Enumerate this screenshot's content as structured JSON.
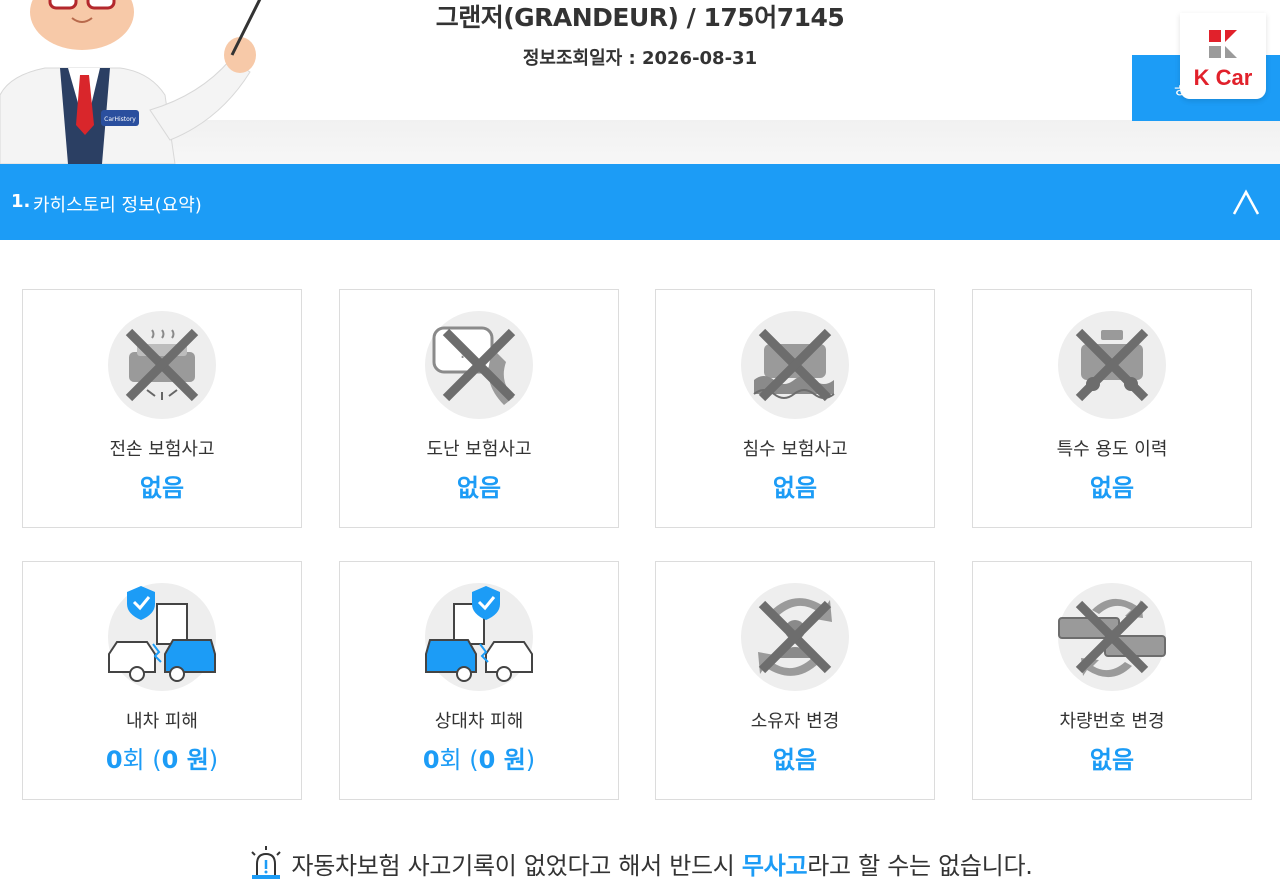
{
  "header": {
    "title": "그랜저(GRANDEUR) / 175어7145",
    "lookup_label": "정보조회일자 : ",
    "lookup_date": "2026-08-31",
    "side_button_label": "ㅎ",
    "brand_logo_text": "K Car",
    "mascot_badge_text": "CarHistory"
  },
  "section": {
    "number": "1.",
    "title": "카히스토리 정보(요약)",
    "toggle_icon": "chevron-up-icon"
  },
  "cards": [
    {
      "label": "전손 보험사고",
      "value": "없음",
      "icon": "total-loss-icon"
    },
    {
      "label": "도난 보험사고",
      "value": "없음",
      "icon": "theft-icon"
    },
    {
      "label": "침수 보험사고",
      "value": "없음",
      "icon": "flood-icon"
    },
    {
      "label": "특수 용도 이력",
      "value": "없음",
      "icon": "special-use-icon"
    },
    {
      "label": "내차 피해",
      "count": "0",
      "count_unit": "회",
      "amount_open": " (",
      "amount": "0",
      "amount_unit": " 원",
      "amount_close": ")",
      "icon": "my-car-damage-icon"
    },
    {
      "label": "상대차 피해",
      "count": "0",
      "count_unit": "회",
      "amount_open": " (",
      "amount": "0",
      "amount_unit": " 원",
      "amount_close": ")",
      "icon": "other-car-damage-icon"
    },
    {
      "label": "소유자 변경",
      "value": "없음",
      "icon": "owner-change-icon"
    },
    {
      "label": "차량번호 변경",
      "value": "없음",
      "icon": "plate-change-icon"
    }
  ],
  "notice": {
    "before": "자동차보험 사고기록이 없었다고 해서 반드시 ",
    "highlight": "무사고",
    "after": "라고 할 수는 없습니다.",
    "icon": "siren-icon"
  },
  "colors": {
    "accent": "#1c9cf6",
    "brand": "#e1212b",
    "disabled_icon": "#8a8a8a"
  }
}
